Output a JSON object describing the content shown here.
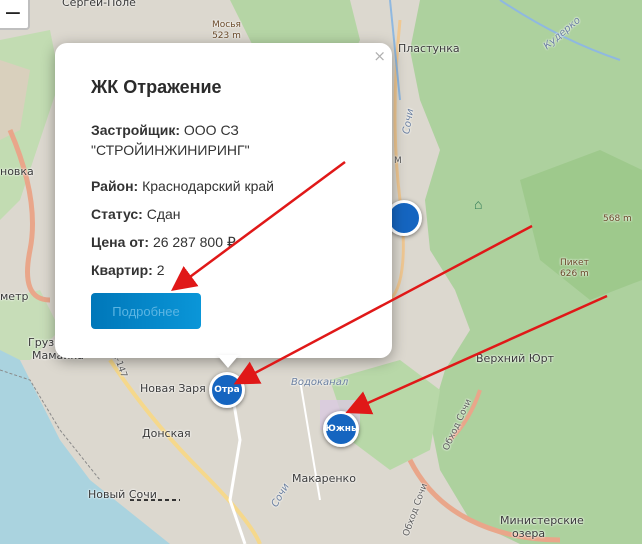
{
  "map": {
    "labels": {
      "sergeev_pole": "Сергей-Поле",
      "plastunka": "Пластунка",
      "mosya": "Мосья",
      "mosya_alt": "523 m",
      "peak_568": "568 m",
      "piket": "Пикет",
      "piket_alt": "626 m",
      "novka": "новка",
      "metr": "метр",
      "gruzi": "Грузи",
      "mamayka": "Мамайка",
      "novaya_zarya": "Новая Заря",
      "donskaya": "Донская",
      "novy_sochi": "Новый Сочи",
      "vodokanal": "Водоканал",
      "makarenko": "Макаренко",
      "verkhny_yurt": "Верхний Юрт",
      "ministerskie_1": "Министерские",
      "ministerskie_2": "озера",
      "sochi_river": "Сочи",
      "sochi_river2": "Сочи",
      "kuderko": "Кудерко",
      "obkhod_sochi": "Обход Сочи",
      "obkhod_sochi2": "Обход Сочи",
      "road_m": "М",
      "road_a147": "А-147",
      "yuzhn_label": "Южн"
    },
    "zoom_out_label": "−"
  },
  "popup": {
    "close_label": "×",
    "title": "ЖК Отражение",
    "rows": [
      {
        "label": "Застройщик:",
        "value": "ООО СЗ \"СТРОЙИНЖИНИРИНГ\""
      },
      {
        "label": "Район:",
        "value": "Краснодарский край"
      },
      {
        "label": "Статус:",
        "value": "Сдан"
      },
      {
        "label": "Цена от:",
        "value": "26 287 800 ₽"
      },
      {
        "label": "Квартир:",
        "value": "2"
      }
    ],
    "button_label": "Подробнее"
  },
  "markers": [
    {
      "label": "Отра",
      "color": "#1565c0"
    },
    {
      "label": "Южнь",
      "color": "#1565c0"
    },
    {
      "label": "",
      "color": "#1565c0"
    }
  ],
  "colors": {
    "forest": "#add19e",
    "urban": "#e0dcd4",
    "sea": "#aad3df",
    "arrow": "#e01818",
    "marker": "#1565c0"
  }
}
